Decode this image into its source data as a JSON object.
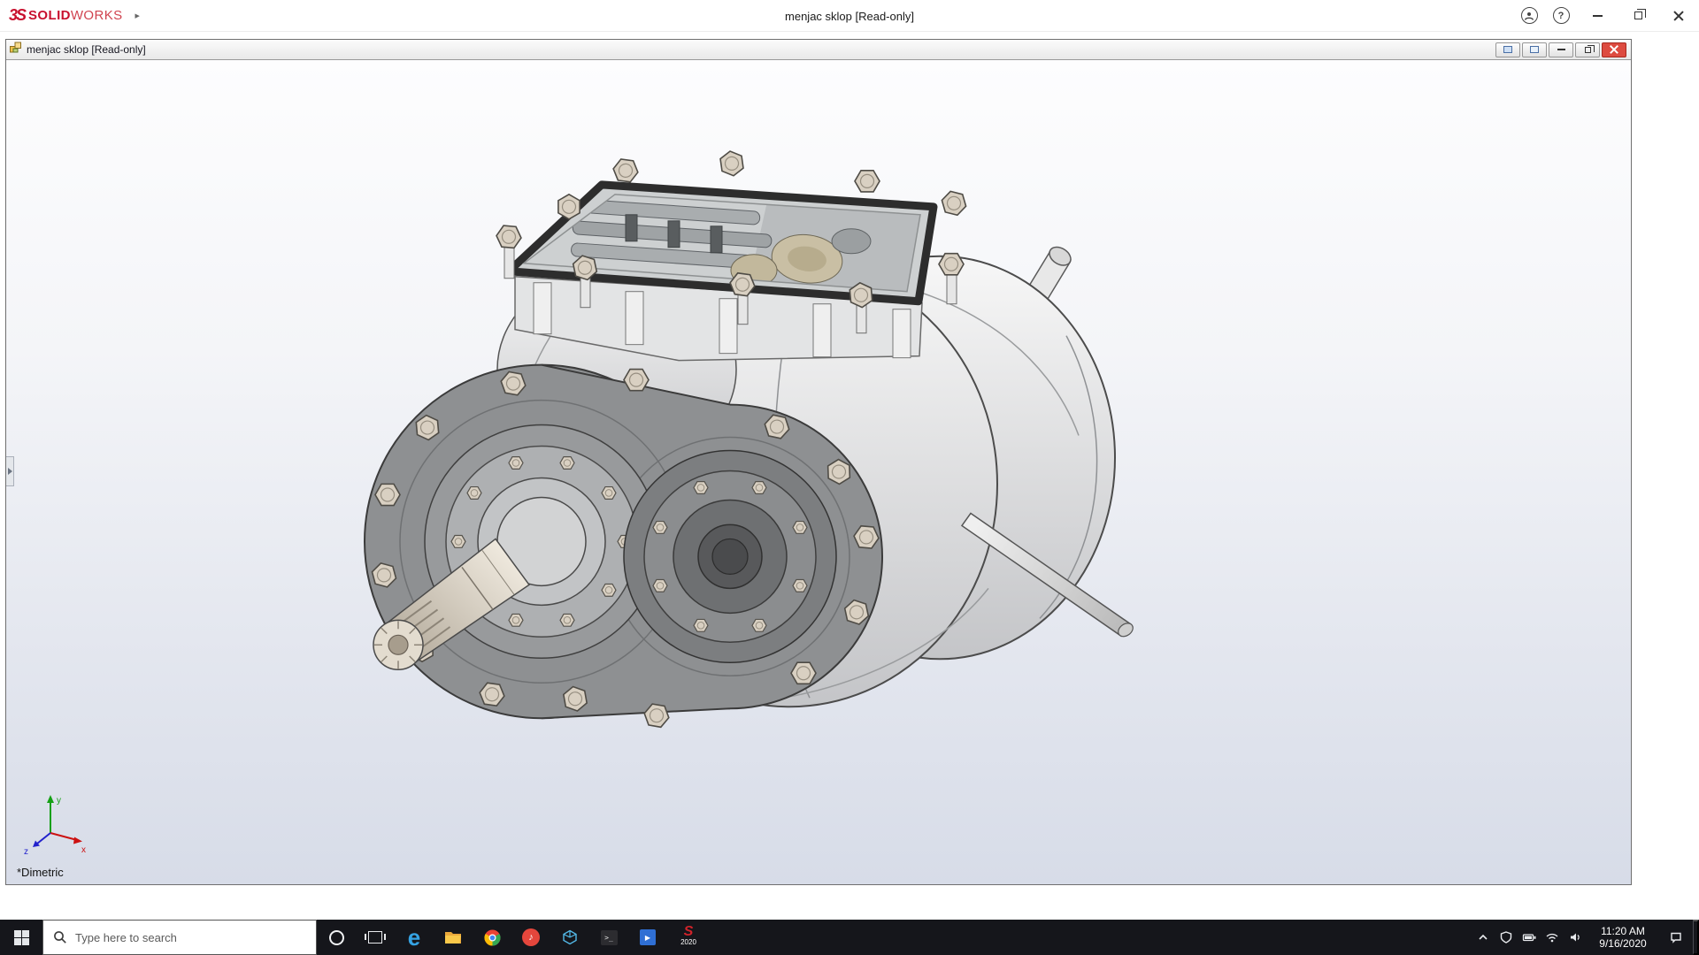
{
  "app": {
    "brand": {
      "mark": "3S",
      "solid": "SOLID",
      "works": "WORKS",
      "expand_glyph": "▶"
    },
    "title": "menjac sklop [Read-only]",
    "help_glyph": "?"
  },
  "doc": {
    "title": "menjac sklop [Read-only]"
  },
  "viewport": {
    "view_label": "*Dimetric",
    "triad": {
      "x": "x",
      "y": "y",
      "z": "z"
    }
  },
  "taskbar": {
    "search_placeholder": "Type here to search",
    "edge_glyph": "e",
    "music_glyph": "♪",
    "terminal_glyph": ">_",
    "movies_glyph": "▶",
    "solidworks_glyph": "S",
    "solidworks_year": "2020",
    "pinned_icons": [
      "start",
      "search",
      "cortana",
      "task-view",
      "edge",
      "file-explorer",
      "chrome",
      "music-app",
      "3d-viewer",
      "terminal",
      "movies-app",
      "solidworks-2020"
    ],
    "tray_icons": [
      "hidden-icons-chevron",
      "security-shield",
      "battery",
      "network",
      "volume",
      "clock",
      "action-center",
      "show-desktop"
    ]
  },
  "tray": {
    "time": "11:20 AM",
    "date": "9/16/2020"
  },
  "colors": {
    "solidworks_red": "#c8102e",
    "doc_close_red": "#dd4b40",
    "taskbar_bg": "#15161b",
    "viewport_top": "#fdfdfe",
    "viewport_bottom": "#d7dce8",
    "gasket_dark": "#2d2d2d",
    "flange_gray": "#8e9092",
    "bolt_beige": "#d9d0c2"
  }
}
